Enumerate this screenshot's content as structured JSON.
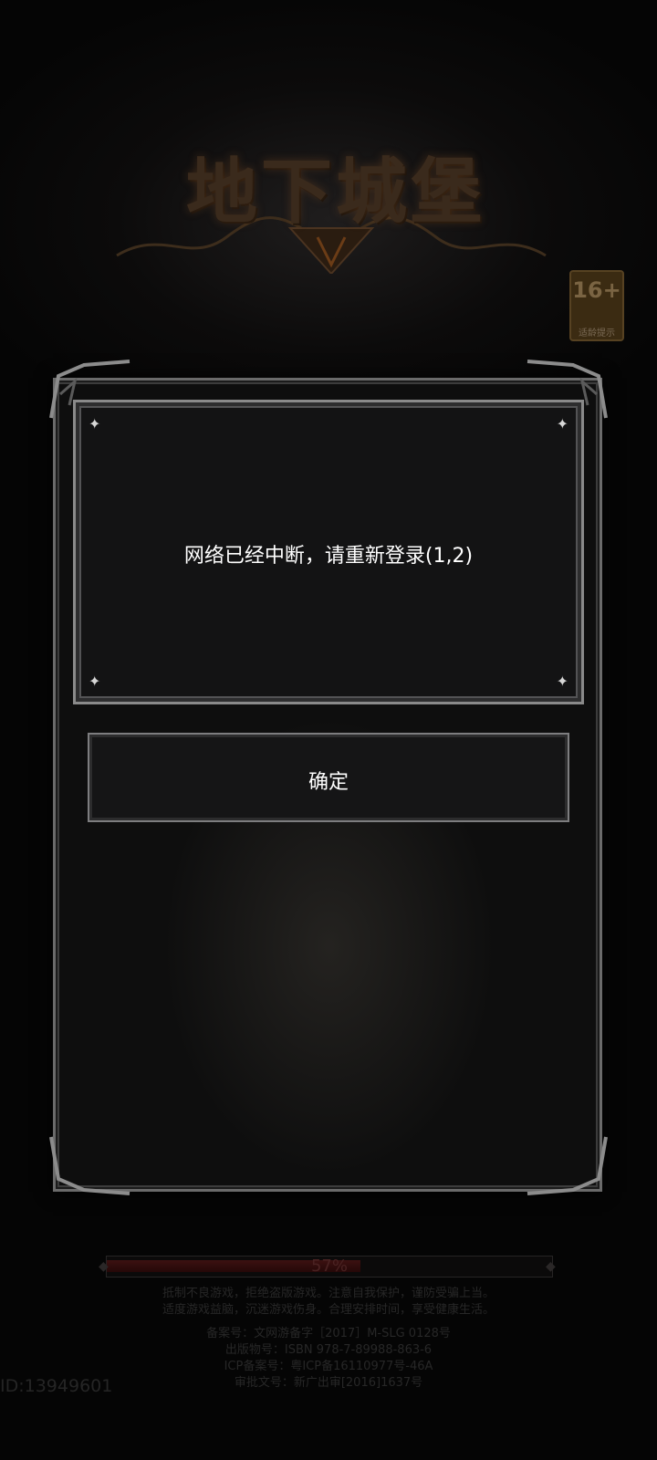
{
  "logo": {
    "title": "地下城堡"
  },
  "age_rating": {
    "number": "16+",
    "caption": "适龄提示"
  },
  "dialog": {
    "message": "网络已经中断，请重新登录(1,2)",
    "confirm_label": "确定"
  },
  "loading": {
    "progress_percent": 57,
    "progress_label": "57%"
  },
  "notices": {
    "health_line_1": "抵制不良游戏，拒绝盗版游戏。注意自我保护，谨防受骗上当。",
    "health_line_2": "适度游戏益脑，沉迷游戏伤身。合理安排时间，享受健康生活。",
    "record_number": "备案号：文网游备字［2017］M-SLG 0128号",
    "publication_number": "出版物号：ISBN 978-7-89988-863-6",
    "icp_number": "ICP备案号：粤ICP备16110977号-46A",
    "approval_number": "审批文号：新广出审[2016]1637号"
  },
  "user": {
    "id_label": "ID:13949601"
  },
  "colors": {
    "accent_text": "#ffffff",
    "frame": "#8a8a8a",
    "progress_fill": "#3c1111"
  }
}
